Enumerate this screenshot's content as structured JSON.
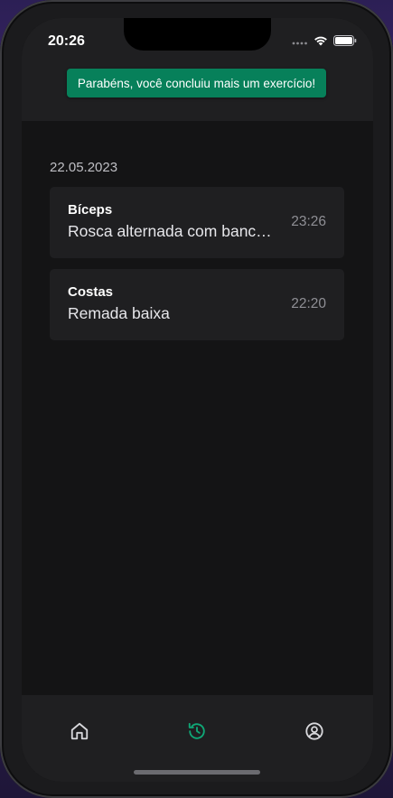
{
  "status_bar": {
    "time": "20:26",
    "icons": [
      "signal-dots-icon",
      "wifi-icon",
      "battery-icon"
    ]
  },
  "toast": {
    "message": "Parabéns, você concluiu mais um exercício!",
    "color": "#07805a"
  },
  "history": {
    "groups": [
      {
        "date": "22.05.2023",
        "items": [
          {
            "muscle": "Bíceps",
            "exercise": "Rosca alternada com banco inclinado",
            "time": "23:26"
          },
          {
            "muscle": "Costas",
            "exercise": "Remada baixa",
            "time": "22:20"
          }
        ]
      }
    ]
  },
  "tab_bar": {
    "tabs": [
      {
        "name": "home",
        "icon": "home-icon",
        "active": false
      },
      {
        "name": "history",
        "icon": "history-icon",
        "active": true
      },
      {
        "name": "profile",
        "icon": "user-circle-icon",
        "active": false
      }
    ],
    "active_color": "#0fa877",
    "inactive_color": "#d8d8dc"
  }
}
